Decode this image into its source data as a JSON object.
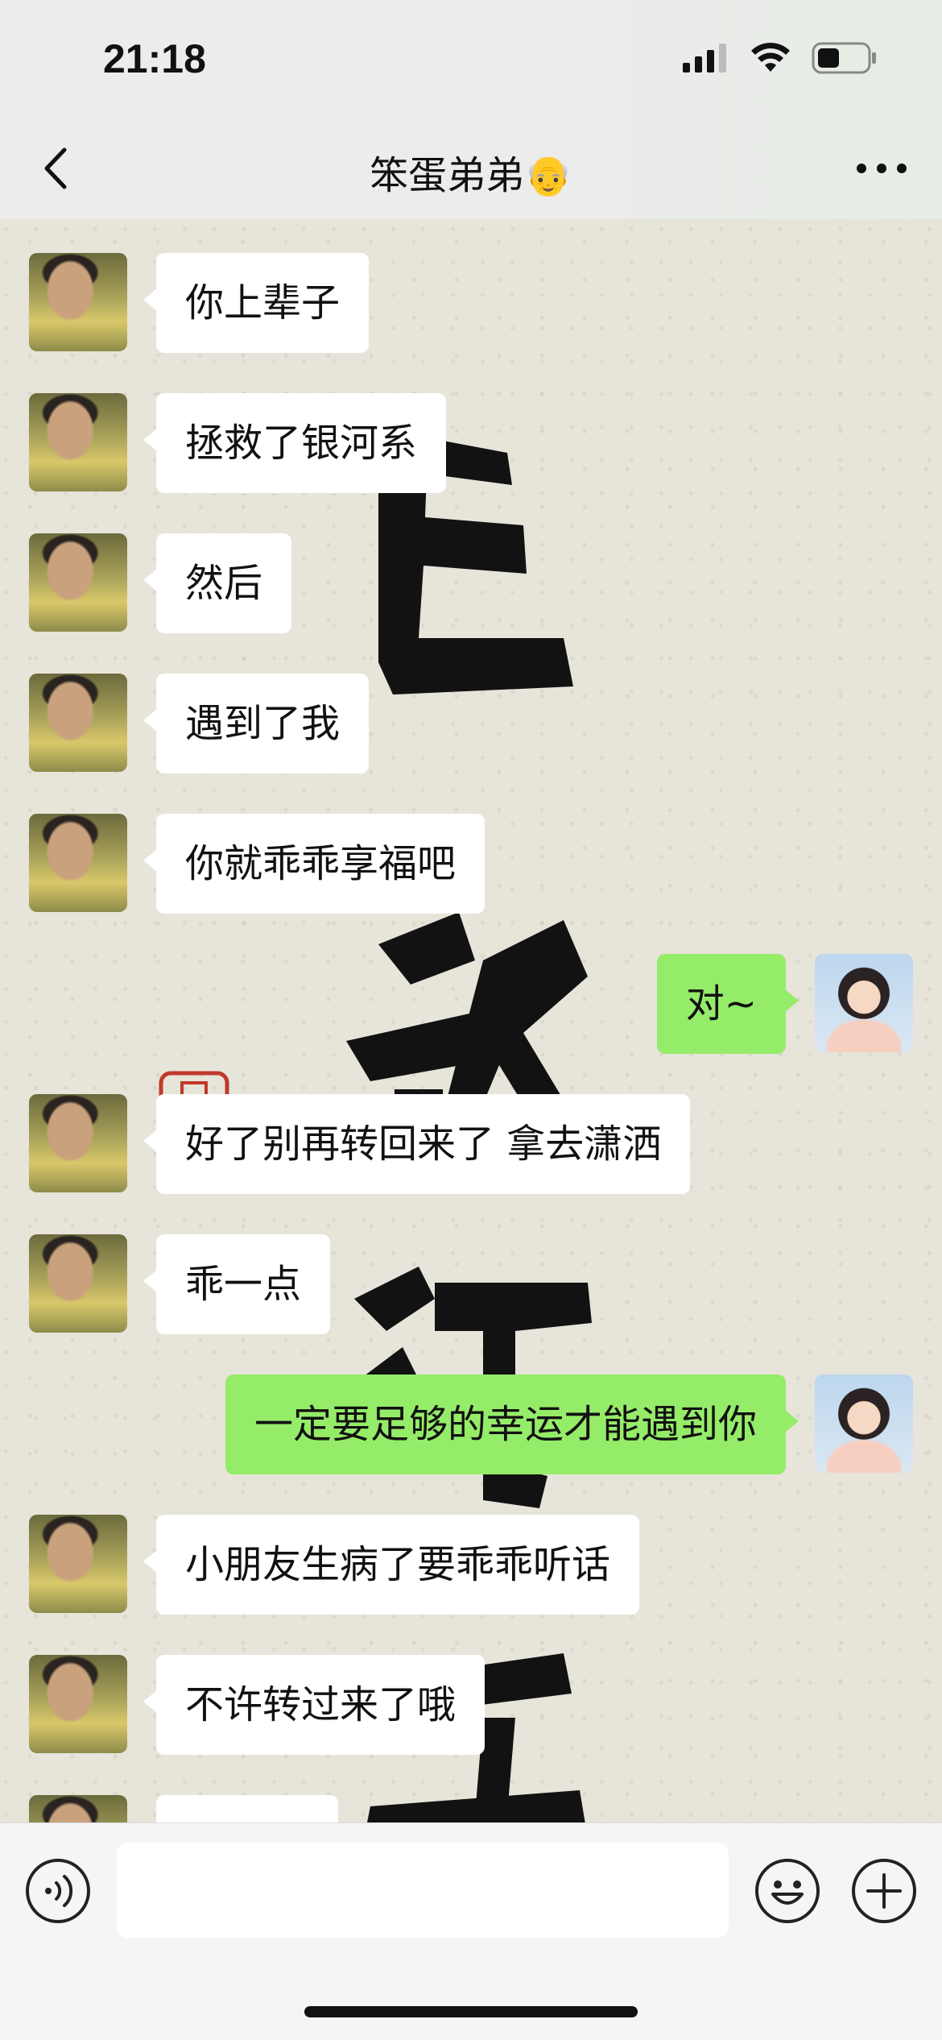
{
  "status_bar": {
    "time": "21:18"
  },
  "header": {
    "title": "笨蛋弟弟👴"
  },
  "messages": [
    {
      "side": "left",
      "text": "你上辈子"
    },
    {
      "side": "left",
      "text": "拯救了银河系"
    },
    {
      "side": "left",
      "text": "然后"
    },
    {
      "side": "left",
      "text": "遇到了我"
    },
    {
      "side": "left",
      "text": "你就乖乖享福吧"
    },
    {
      "side": "right",
      "text": "对~"
    },
    {
      "side": "left",
      "text": "好了别再转回来了 拿去潇洒"
    },
    {
      "side": "left",
      "text": "乖一点"
    },
    {
      "side": "right",
      "text": "一定要足够的幸运才能遇到你"
    },
    {
      "side": "left",
      "text": "小朋友生病了要乖乖听话"
    },
    {
      "side": "left",
      "text": "不许转过来了哦"
    },
    {
      "side": "left",
      "text": ""
    }
  ],
  "input": {
    "value": "",
    "placeholder": ""
  },
  "colors": {
    "outgoing_bubble": "#95ec69",
    "incoming_bubble": "#ffffff",
    "bar_background": "#ececec"
  },
  "icons": {
    "back": "chevron-left-icon",
    "more": "more-dots-icon",
    "voice": "voice-icon",
    "emoji": "emoji-icon",
    "plus": "plus-icon"
  }
}
